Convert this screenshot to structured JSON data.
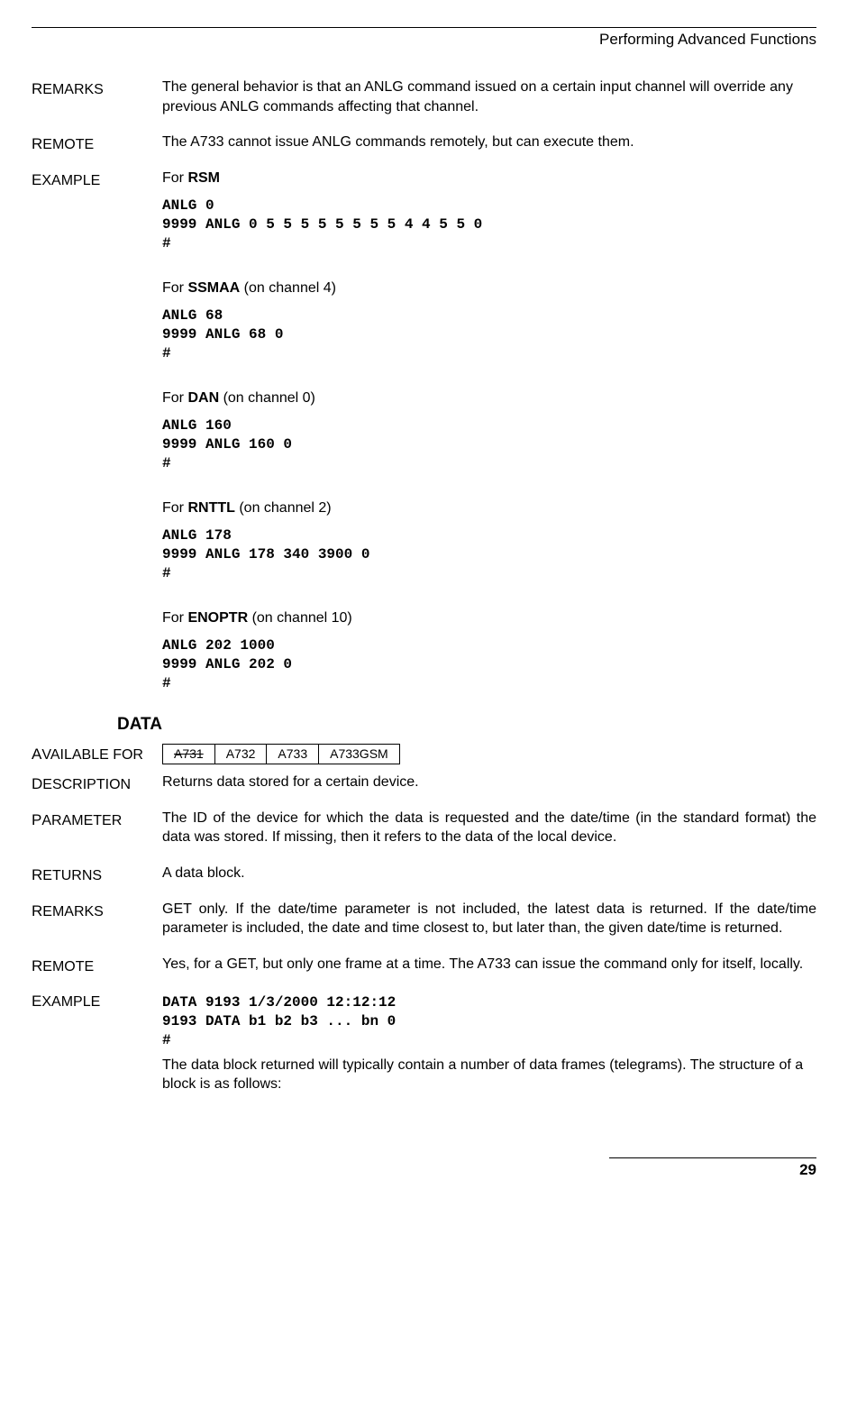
{
  "header": "Performing Advanced Functions",
  "labels": {
    "remarks": "Remarks",
    "remote": "Remote",
    "example": "Example",
    "available_for": "Available for",
    "description": "Description",
    "parameter": "Parameter",
    "returns": "Returns"
  },
  "remarks1": "The general behavior is that an ANLG  command issued on a certain input channel will override any previous ANLG commands affecting that channel.",
  "remote1": "The A733 cannot issue ANLG commands remotely, but can execute them.",
  "ex": {
    "for": "For ",
    "rsm": "RSM",
    "rsm_code": "ANLG 0\n9999 ANLG 0 5 5 5 5 5 5 5 5 4 4 5 5 0\n#",
    "ssmaa": "SSMAA",
    "ssmaa_tail": " (on channel 4)",
    "ssmaa_code": "ANLG 68\n9999 ANLG 68 0\n#",
    "dan": "DAN",
    "dan_tail": " (on channel 0)",
    "dan_code": "ANLG 160\n9999 ANLG 160 0\n#",
    "rnttl": "RNTTL",
    "rnttl_tail": " (on channel 2)",
    "rnttl_code": "ANLG 178\n9999 ANLG 178 340 3900 0\n#",
    "enoptr": "ENOPTR",
    "enoptr_tail": " (on channel 10)",
    "enoptr_code": "ANLG 202 1000\n9999 ANLG 202 0\n#"
  },
  "section": "DATA",
  "avail": {
    "a731": "A731",
    "a732": "A732",
    "a733": "A733",
    "a733gsm": "A733GSM"
  },
  "desc": "Returns data stored for a certain device.",
  "param": "The ID of the device for which the data is requested and the date/time (in the standard format) the data was stored. If missing, then it refers to the data of the local device.",
  "returns1": "A data block.",
  "remarks2": "GET only. If the date/time parameter is not included, the latest data is returned. If the date/time parameter is included, the date and time closest to, but later than, the given date/time is returned.",
  "remote2": "Yes, for a GET, but only one frame at a time. The A733 can issue the command only for itself, locally.",
  "data_code": "DATA 9193 1/3/2000 12:12:12\n9193 DATA b1 b2 b3 ... bn 0\n#",
  "data_tail": "The data block returned will typically contain a number of data frames (telegrams). The structure of a block is as follows:",
  "page": "29"
}
